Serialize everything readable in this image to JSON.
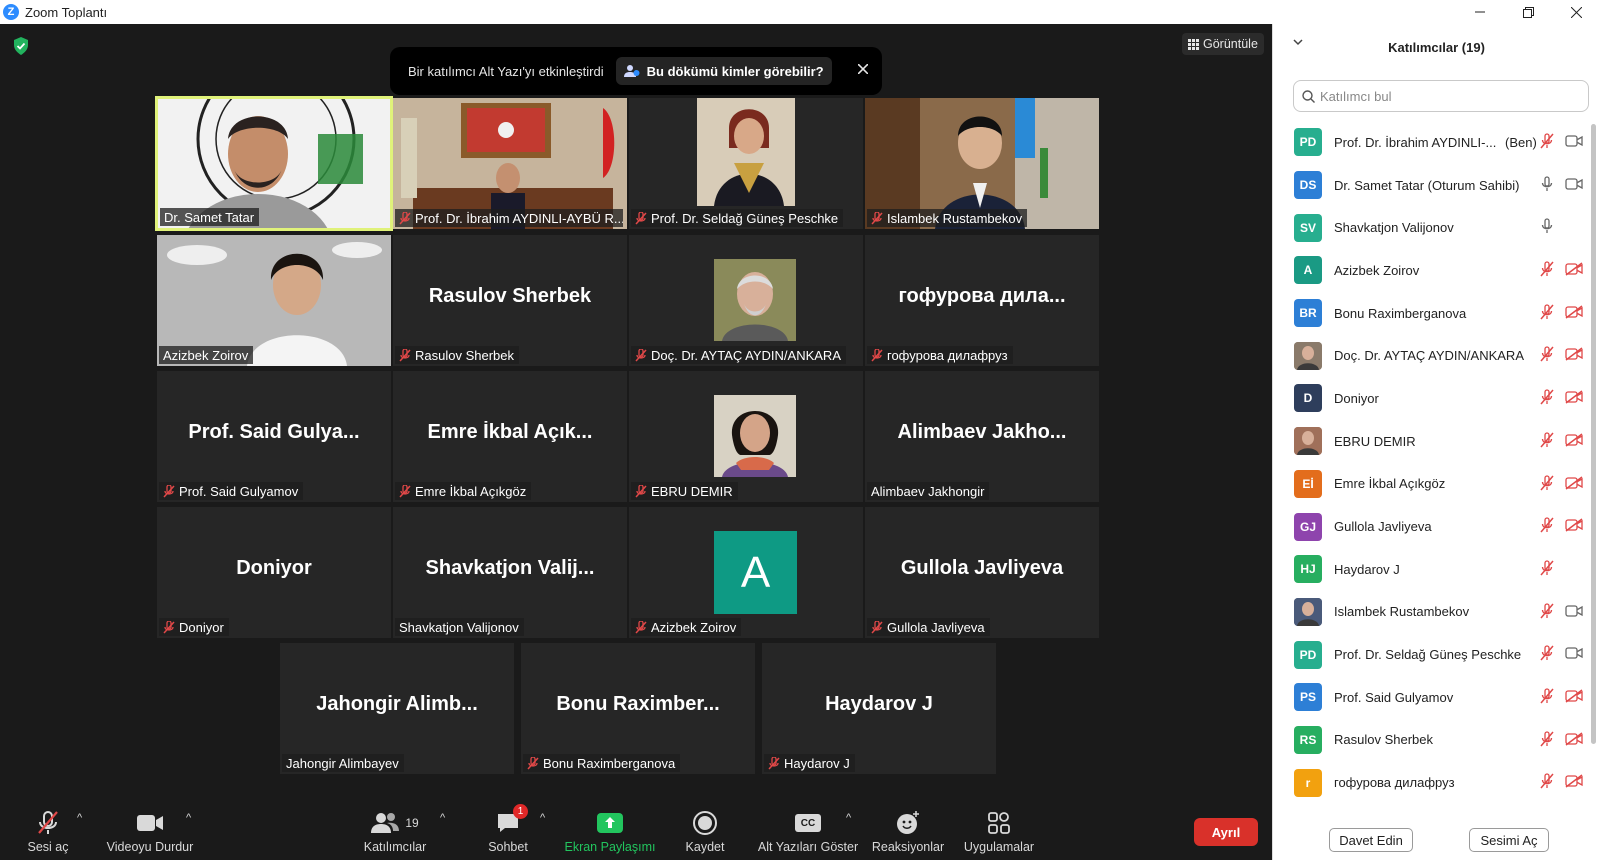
{
  "window": {
    "title": "Zoom Toplantı",
    "logo_letter": "Z"
  },
  "stage": {
    "view_button": "Görüntüle",
    "caption_banner": {
      "text": "Bir katılımcı Alt Yazı'yı etkinleştirdi",
      "button": "Bu dökümü kimler görebilir?"
    }
  },
  "tiles": [
    {
      "label": "Dr. Samet Tatar",
      "muted": false,
      "type": "video",
      "active": true
    },
    {
      "label": "Prof. Dr. İbrahim AYDINLI-AYBÜ R...",
      "muted": true,
      "type": "video"
    },
    {
      "label": "Prof. Dr. Seldağ Güneş Peschke",
      "muted": true,
      "type": "video"
    },
    {
      "label": "Islambek Rustambekov",
      "muted": true,
      "type": "video"
    },
    {
      "label": "Azizbek Zoirov",
      "muted": false,
      "type": "video"
    },
    {
      "label": "Rasulov Sherbek",
      "big": "Rasulov Sherbek",
      "muted": true
    },
    {
      "label": "Doç. Dr. AYTAÇ AYDIN/ANKARA",
      "muted": true,
      "type": "photo"
    },
    {
      "label": "гофурова дилафруз",
      "big": "гофурова  дила...",
      "muted": true
    },
    {
      "label": "Prof. Said Gulyamov",
      "big": "Prof.  Said  Gulya...",
      "muted": true
    },
    {
      "label": "Emre İkbal Açıkgöz",
      "big": "Emre  İkbal  Açık...",
      "muted": true
    },
    {
      "label": "EBRU DEMIR",
      "muted": true,
      "type": "photo"
    },
    {
      "label": "Alimbaev Jakhongir",
      "big": "Alimbaev  Jakho...",
      "muted": false
    },
    {
      "label": "Doniyor",
      "big": "Doniyor",
      "muted": true
    },
    {
      "label": "Shavkatjon Valijonov",
      "big": "Shavkatjon  Valij...",
      "muted": false
    },
    {
      "label": "Azizbek Zoirov",
      "muted": true,
      "type": "avatar",
      "avatar_letter": "A"
    },
    {
      "label": "Gullola Javliyeva",
      "big": "Gullola  Javliyeva",
      "muted": true
    },
    {
      "label": "Jahongir Alimbayev",
      "big": "Jahongir  Alimb...",
      "muted": false
    },
    {
      "label": "Bonu Raximberganova",
      "big": "Bonu  Raximber...",
      "muted": true
    },
    {
      "label": "Haydarov J",
      "big": "Haydarov J",
      "muted": true
    }
  ],
  "toolbar": {
    "unmute": "Sesi aç",
    "stop_video": "Videoyu Durdur",
    "participants": "Katılımcılar",
    "participants_count": "19",
    "chat": "Sohbet",
    "chat_badge": "1",
    "share": "Ekran Paylaşımı",
    "record": "Kaydet",
    "captions": "Alt Yazıları Göster",
    "cc": "CC",
    "reactions": "Reaksiyonlar",
    "apps": "Uygulamalar",
    "leave": "Ayrıl"
  },
  "panel": {
    "title": "Katılımcılar (19)",
    "search_placeholder": "Katılımcı bul",
    "invite": "Davet Edin",
    "unmute_me": "Sesimi Aç",
    "participants": [
      {
        "initials": "PD",
        "name": "Prof. Dr. İbrahim AYDINLI-...",
        "suffix": "(Ben)",
        "color": "#27ae8f",
        "mic": "muted",
        "cam": "on"
      },
      {
        "initials": "DS",
        "name": "Dr. Samet Tatar (Oturum Sahibi)",
        "color": "#2d7fd6",
        "mic": "on",
        "cam": "on"
      },
      {
        "initials": "SV",
        "name": "Shavkatjon Valijonov",
        "color": "#27ae8f",
        "mic": "on",
        "cam": "none"
      },
      {
        "initials": "A",
        "name": "Azizbek Zoirov",
        "color": "#1a9a84",
        "mic": "muted",
        "cam": "off"
      },
      {
        "initials": "BR",
        "name": "Bonu Raximberganova",
        "color": "#2d7fd6",
        "mic": "muted",
        "cam": "off"
      },
      {
        "initials": "",
        "name": "Doç. Dr. AYTAÇ AYDIN/ANKARA",
        "color": "#8a7a6a",
        "mic": "muted",
        "cam": "off",
        "photo": true
      },
      {
        "initials": "D",
        "name": "Doniyor",
        "color": "#2e3e5c",
        "mic": "muted",
        "cam": "off"
      },
      {
        "initials": "",
        "name": "EBRU DEMIR",
        "color": "#a0705a",
        "mic": "muted",
        "cam": "off",
        "photo": true
      },
      {
        "initials": "Eİ",
        "name": "Emre İkbal Açıkgöz",
        "color": "#e36d1c",
        "mic": "muted",
        "cam": "off"
      },
      {
        "initials": "GJ",
        "name": "Gullola Javliyeva",
        "color": "#8e44ad",
        "mic": "muted",
        "cam": "off"
      },
      {
        "initials": "HJ",
        "name": "Haydarov J",
        "color": "#27ae60",
        "mic": "muted",
        "cam": "none"
      },
      {
        "initials": "",
        "name": "Islambek Rustambekov",
        "color": "#4a5a7a",
        "mic": "muted",
        "cam": "on",
        "photo": true
      },
      {
        "initials": "PD",
        "name": "Prof. Dr. Seldağ Güneş Peschke",
        "color": "#27ae8f",
        "mic": "muted",
        "cam": "on"
      },
      {
        "initials": "PS",
        "name": "Prof. Said Gulyamov",
        "color": "#2d7fd6",
        "mic": "muted",
        "cam": "off"
      },
      {
        "initials": "RS",
        "name": "Rasulov Sherbek",
        "color": "#27ae60",
        "mic": "muted",
        "cam": "off"
      },
      {
        "initials": "r",
        "name": "гофурова дилафруз",
        "color": "#f2a10f",
        "mic": "muted",
        "cam": "off"
      }
    ]
  }
}
